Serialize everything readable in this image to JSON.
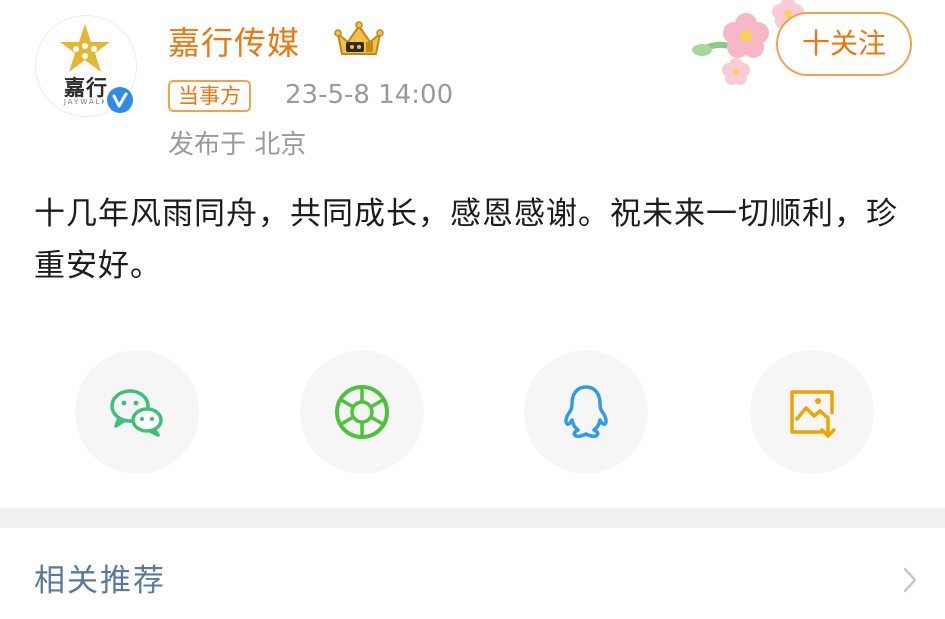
{
  "author": {
    "name": "嘉行传媒",
    "avatar_text": "嘉行",
    "avatar_subtext": "JAYWALK",
    "badge": "当事方",
    "timestamp": "23-5-8 14:00",
    "location": "发布于 北京"
  },
  "follow_button": {
    "label": "十关注"
  },
  "post": {
    "text": "十几年风雨同舟，共同成长，感恩感谢。祝未来一切顺利，珍重安好。"
  },
  "share_actions": [
    {
      "icon": "wechat-icon",
      "color": "#3ec07a"
    },
    {
      "icon": "moments-icon",
      "color": "#4ec23d"
    },
    {
      "icon": "qq-icon",
      "color": "#2d9de8"
    },
    {
      "icon": "save-image-icon",
      "color": "#f0a400"
    }
  ],
  "footer": {
    "related_label": "相关推荐"
  },
  "colors": {
    "accent": "#e8780f",
    "muted": "#9a9a9a",
    "link": "#5a7a9a"
  }
}
